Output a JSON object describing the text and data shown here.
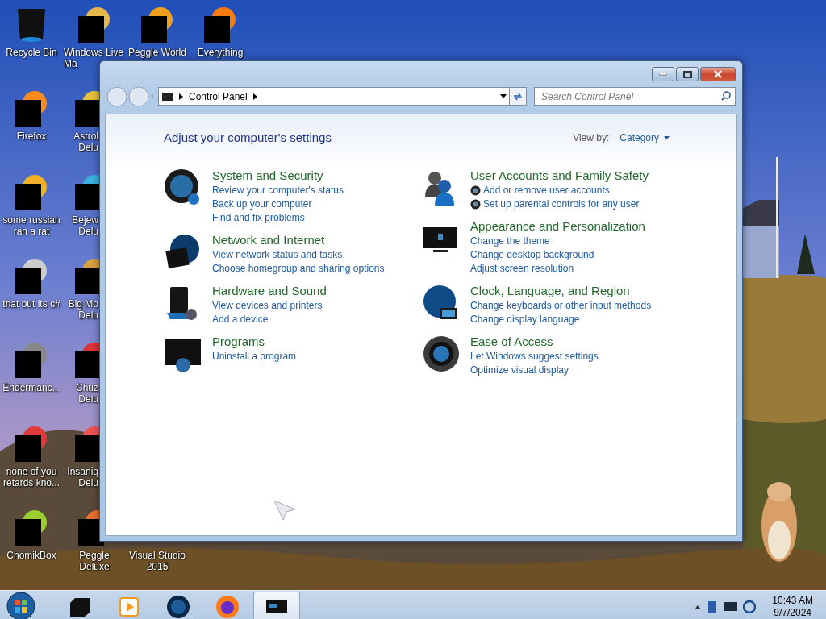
{
  "desktop": {
    "icons": [
      {
        "label": "Recycle Bin",
        "kind": "app"
      },
      {
        "label": "Windows Live Ma",
        "kind": "app"
      },
      {
        "label": "Peggle World",
        "kind": "app"
      },
      {
        "label": "Everything",
        "kind": "app"
      },
      {
        "label": "Firefox",
        "kind": "app"
      },
      {
        "label": "Astrol Delu",
        "kind": "app"
      },
      {
        "label": "some russian ran a rat",
        "kind": "app"
      },
      {
        "label": "Bejew Delu",
        "kind": "app"
      },
      {
        "label": "that but its c#",
        "kind": "app"
      },
      {
        "label": "Big Mo Delu",
        "kind": "app"
      },
      {
        "label": "Endermanc...",
        "kind": "app"
      },
      {
        "label": "Chuz Delu",
        "kind": "app"
      },
      {
        "label": "none of you retards kno...",
        "kind": "app"
      },
      {
        "label": "Insaniq Delu",
        "kind": "app"
      },
      {
        "label": "ChomikBox",
        "kind": "app"
      },
      {
        "label": "Peggle Deluxe",
        "kind": "app"
      },
      {
        "label": "Visual Studio 2015",
        "kind": "label"
      }
    ]
  },
  "window": {
    "address": {
      "crumbs": [
        "Control Panel"
      ]
    },
    "search": {
      "placeholder": "Search Control Panel"
    },
    "heading": "Adjust your computer's settings",
    "view_by": {
      "label": "View by:",
      "value": "Category"
    },
    "columns": [
      {
        "categories": [
          {
            "title": "System and Security",
            "links": [
              {
                "text": "Review your computer's status",
                "shield": false
              },
              {
                "text": "Back up your computer",
                "shield": false
              },
              {
                "text": "Find and fix problems",
                "shield": false
              }
            ]
          },
          {
            "title": "Network and Internet",
            "links": [
              {
                "text": "View network status and tasks",
                "shield": false
              },
              {
                "text": "Choose homegroup and sharing options",
                "shield": false
              }
            ]
          },
          {
            "title": "Hardware and Sound",
            "links": [
              {
                "text": "View devices and printers",
                "shield": false
              },
              {
                "text": "Add a device",
                "shield": false
              }
            ]
          },
          {
            "title": "Programs",
            "links": [
              {
                "text": "Uninstall a program",
                "shield": false
              }
            ]
          }
        ]
      },
      {
        "categories": [
          {
            "title": "User Accounts and Family Safety",
            "links": [
              {
                "text": "Add or remove user accounts",
                "shield": true
              },
              {
                "text": "Set up parental controls for any user",
                "shield": true
              }
            ]
          },
          {
            "title": "Appearance and Personalization",
            "links": [
              {
                "text": "Change the theme",
                "shield": false
              },
              {
                "text": "Change desktop background",
                "shield": false
              },
              {
                "text": "Adjust screen resolution",
                "shield": false
              }
            ]
          },
          {
            "title": "Clock, Language, and Region",
            "links": [
              {
                "text": "Change keyboards or other input methods",
                "shield": false
              },
              {
                "text": "Change display language",
                "shield": false
              }
            ]
          },
          {
            "title": "Ease of Access",
            "links": [
              {
                "text": "Let Windows suggest settings",
                "shield": false
              },
              {
                "text": "Optimize visual display",
                "shield": false
              }
            ]
          }
        ]
      }
    ]
  },
  "taskbar": {
    "items": [
      {
        "selected": false
      },
      {
        "selected": false
      },
      {
        "selected": false
      },
      {
        "selected": false
      },
      {
        "selected": true
      }
    ],
    "clock": {
      "time": "10:43 AM",
      "date": "9/7/2024"
    }
  }
}
